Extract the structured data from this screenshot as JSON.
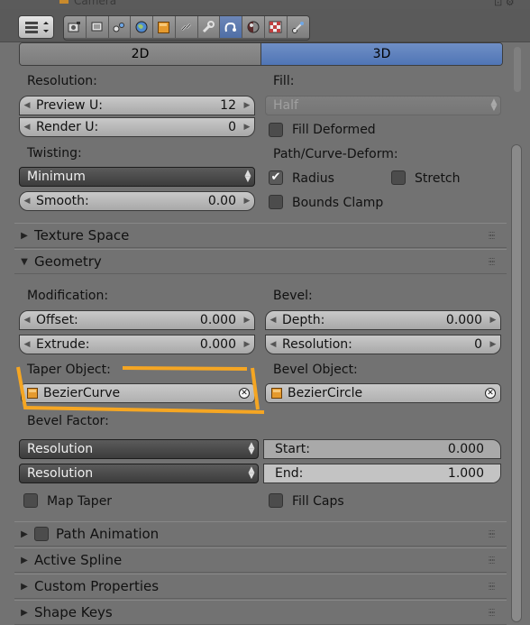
{
  "window": {
    "title_fragment": "Camera"
  },
  "header": {
    "menu_icon": "editor-type-menu-icon",
    "context_tabs": [
      {
        "name": "render-icon",
        "active": false
      },
      {
        "name": "render-layers-icon",
        "active": false
      },
      {
        "name": "scene-icon",
        "active": false
      },
      {
        "name": "world-icon",
        "active": false
      },
      {
        "name": "object-icon",
        "active": false
      },
      {
        "name": "constraints-icon",
        "active": false
      },
      {
        "name": "modifiers-wrench-icon",
        "active": false
      },
      {
        "name": "curve-data-icon",
        "active": true
      },
      {
        "name": "material-icon",
        "active": false
      },
      {
        "name": "texture-icon",
        "active": false
      },
      {
        "name": "physics-icon",
        "active": false
      }
    ]
  },
  "mode_toggle": {
    "options": [
      "2D",
      "3D"
    ],
    "selected": "3D"
  },
  "shape": {
    "resolution_label": "Resolution:",
    "preview_u": {
      "label": "Preview U:",
      "value": "12"
    },
    "render_u": {
      "label": "Render U:",
      "value": "0"
    },
    "fill_label": "Fill:",
    "fill_value": "Half",
    "fill_deformed": {
      "label": "Fill Deformed",
      "checked": false
    },
    "twisting_label": "Twisting:",
    "twisting_value": "Minimum",
    "smooth": {
      "label": "Smooth:",
      "value": "0.00"
    },
    "path_deform_label": "Path/Curve-Deform:",
    "radius": {
      "label": "Radius",
      "checked": true
    },
    "stretch": {
      "label": "Stretch",
      "checked": false
    },
    "bounds_clamp": {
      "label": "Bounds Clamp",
      "checked": false
    }
  },
  "panels": {
    "texture_space": "Texture Space",
    "geometry": "Geometry",
    "path_animation": "Path Animation",
    "active_spline": "Active Spline",
    "custom_properties": "Custom Properties",
    "shape_keys": "Shape Keys"
  },
  "geometry": {
    "modification_label": "Modification:",
    "offset": {
      "label": "Offset:",
      "value": "0.000"
    },
    "extrude": {
      "label": "Extrude:",
      "value": "0.000"
    },
    "bevel_label": "Bevel:",
    "depth": {
      "label": "Depth:",
      "value": "0.000"
    },
    "resolution": {
      "label": "Resolution:",
      "value": "0"
    },
    "taper_label": "Taper Object:",
    "taper_value": "BezierCurve",
    "bevel_obj_label": "Bevel Object:",
    "bevel_obj_value": "BezierCircle",
    "bevel_factor_label": "Bevel Factor:",
    "factor_mode_1": "Resolution",
    "factor_mode_2": "Resolution",
    "start": {
      "label": "Start:",
      "value": "0.000",
      "fraction": 0.0
    },
    "end": {
      "label": "End:",
      "value": "1.000",
      "fraction": 1.0
    },
    "map_taper": {
      "label": "Map Taper",
      "checked": false
    },
    "fill_caps": {
      "label": "Fill Caps",
      "checked": false
    }
  },
  "colors": {
    "accent_blue": "#5075b5",
    "highlight_orange": "#f5a623"
  }
}
